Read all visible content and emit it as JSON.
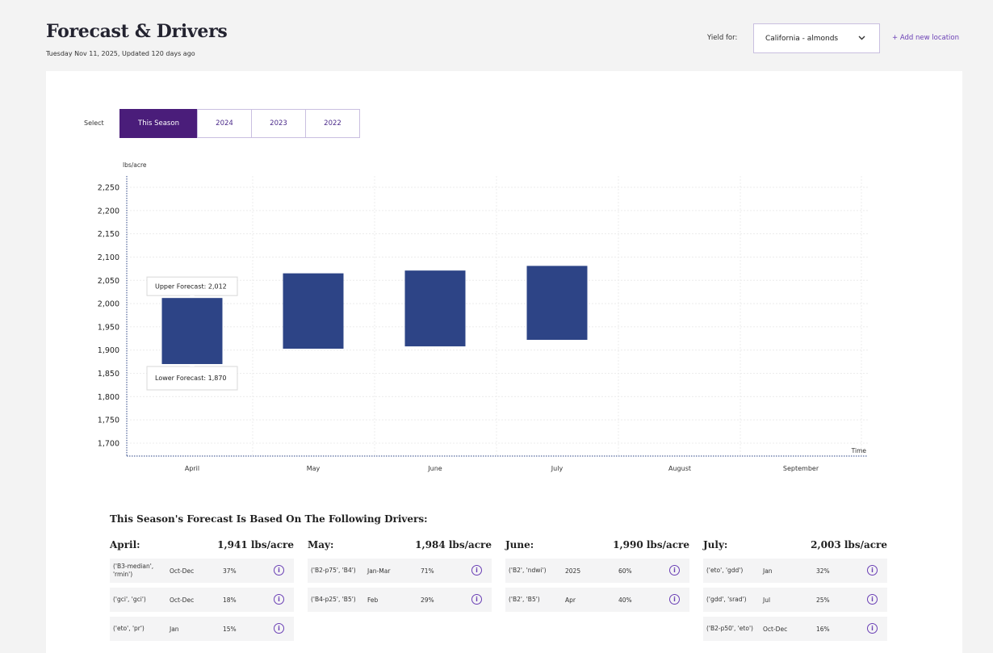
{
  "header": {
    "title": "Forecast & Drivers",
    "subtitle": "Tuesday Nov 11, 2025, Updated 120 days ago",
    "yield_label": "Yield for:",
    "location_value": "California - almonds",
    "add_location": "+ Add new location"
  },
  "season_select": {
    "label": "Select",
    "tabs": [
      "This Season",
      "2024",
      "2023",
      "2022"
    ],
    "active": 0
  },
  "colors": {
    "bar": "#2d4486",
    "active_tab": "#4a1d7a",
    "accent": "#6a3fb5"
  },
  "chart_data": {
    "type": "range-bar",
    "ylabel": "lbs/acre",
    "xlabel": "Time",
    "ylim": [
      1700,
      2250
    ],
    "yticks": [
      "2,250",
      "2,200",
      "2,150",
      "2,100",
      "2,050",
      "2,000",
      "1,950",
      "1,900",
      "1,850",
      "1,800",
      "1,750",
      "1,700"
    ],
    "categories": [
      "April",
      "May",
      "June",
      "July",
      "August",
      "September"
    ],
    "series": [
      {
        "low": [
          1870,
          1903,
          1908,
          1922,
          null,
          null
        ],
        "high": [
          2012,
          2065,
          2071,
          2081,
          null,
          null
        ]
      }
    ],
    "tooltips": {
      "category": "April",
      "upper_text": "Upper Forecast: 2,012",
      "lower_text": "Lower Forecast: 1,870"
    },
    "grid": true
  },
  "drivers": {
    "heading": "This Season's Forecast Is Based On The Following Drivers:",
    "columns": [
      {
        "month": "April:",
        "value": "1,941 lbs/acre",
        "rows": [
          {
            "feature": "('B3-median', 'rmin')",
            "period": "Oct-Dec",
            "pct": "37%"
          },
          {
            "feature": "('gci', 'gci')",
            "period": "Oct-Dec",
            "pct": "18%"
          },
          {
            "feature": "('eto', 'pr')",
            "period": "Jan",
            "pct": "15%"
          }
        ]
      },
      {
        "month": "May:",
        "value": "1,984 lbs/acre",
        "rows": [
          {
            "feature": "('B2-p75', 'B4')",
            "period": "Jan-Mar",
            "pct": "71%"
          },
          {
            "feature": "('B4-p25', 'B5')",
            "period": "Feb",
            "pct": "29%"
          }
        ]
      },
      {
        "month": "June:",
        "value": "1,990 lbs/acre",
        "rows": [
          {
            "feature": "('B2', 'ndwi')",
            "period": "2025",
            "pct": "60%"
          },
          {
            "feature": "('B2', 'B5')",
            "period": "Apr",
            "pct": "40%"
          }
        ]
      },
      {
        "month": "July:",
        "value": "2,003 lbs/acre",
        "rows": [
          {
            "feature": "('eto', 'gdd')",
            "period": "Jan",
            "pct": "32%"
          },
          {
            "feature": "('gdd', 'srad')",
            "period": "Jul",
            "pct": "25%"
          },
          {
            "feature": "('B2-p50', 'eto')",
            "period": "Oct-Dec",
            "pct": "16%"
          }
        ]
      }
    ],
    "info_glyph": "i"
  }
}
